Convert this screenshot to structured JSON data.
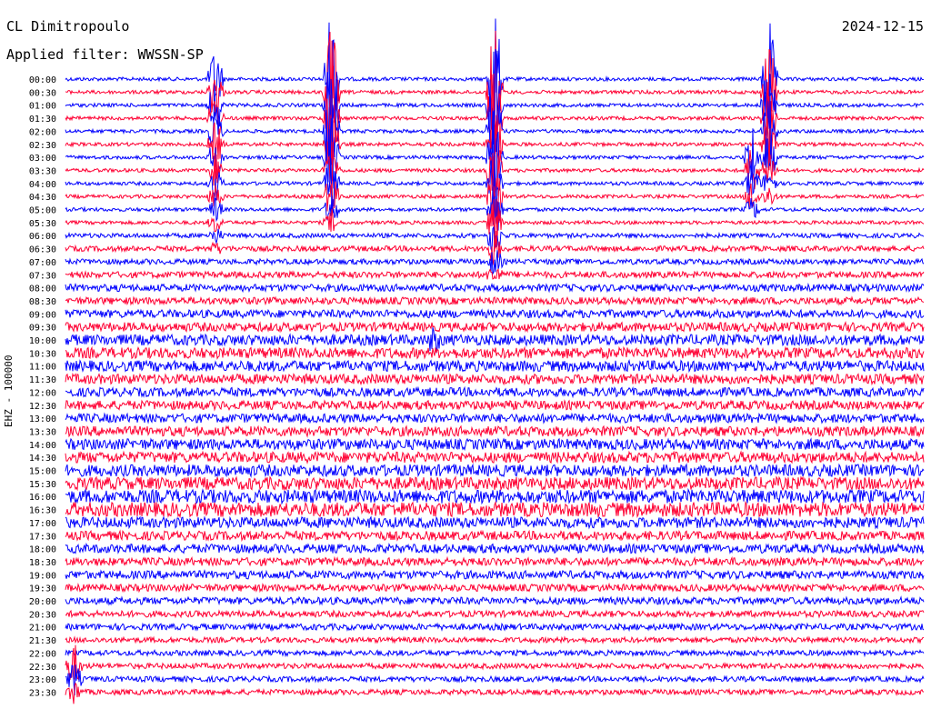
{
  "header": {
    "station": "CL Dimitropoulo",
    "date": "2024-12-15",
    "filter": "Applied filter: WWSSN-SP",
    "channel": "EHZ - 100000"
  },
  "chart_data": {
    "type": "helicorder",
    "title": "CL Dimitropoulo",
    "date": "2024-12-15",
    "filter": "WWSSN-SP",
    "ylabel": "EHZ - 100000",
    "row_minutes": 15,
    "rows": 48,
    "tick_labels": [
      "00:00",
      "00:30",
      "01:00",
      "01:30",
      "02:00",
      "02:30",
      "03:00",
      "03:30",
      "04:00",
      "04:30",
      "05:00",
      "05:30",
      "06:00",
      "06:30",
      "07:00",
      "07:30",
      "08:00",
      "08:30",
      "09:00",
      "09:30",
      "10:00",
      "10:30",
      "11:00",
      "11:30",
      "12:00",
      "12:30",
      "13:00",
      "13:30",
      "14:00",
      "14:30",
      "15:00",
      "15:30",
      "16:00",
      "16:30",
      "17:00",
      "17:30",
      "18:00",
      "18:30",
      "19:00",
      "19:30",
      "20:00",
      "20:30",
      "21:00",
      "21:30",
      "22:00",
      "22:30",
      "23:00",
      "23:30"
    ],
    "trace_colors": [
      "#0000ff",
      "#ff0033"
    ],
    "noise_profile": [
      2,
      2,
      2,
      2,
      2,
      2,
      2,
      2,
      2,
      2,
      2,
      2,
      2.5,
      3,
      3,
      3.5,
      4,
      4,
      4.5,
      5,
      6,
      6,
      6,
      5.5,
      5,
      5,
      5,
      5.5,
      6,
      6,
      6.5,
      7,
      7.5,
      8,
      6,
      5,
      5,
      4.5,
      4.5,
      4,
      4,
      3.5,
      3.5,
      3,
      3,
      3,
      3,
      3
    ],
    "events": [
      {
        "row": 0,
        "x_frac": 0.31,
        "amp": 90,
        "rows_span": 12
      },
      {
        "row": 0,
        "x_frac": 0.5,
        "amp": 90,
        "rows_span": 16
      },
      {
        "row": 0,
        "x_frac": 0.82,
        "amp": 70,
        "rows_span": 10
      },
      {
        "row": 0,
        "x_frac": 0.175,
        "amp": 40,
        "rows_span": 14
      },
      {
        "row": 6,
        "x_frac": 0.8,
        "amp": 40,
        "rows_span": 5
      },
      {
        "row": 20,
        "x_frac": 0.43,
        "amp": 12,
        "rows_span": 1
      },
      {
        "row": 45,
        "x_frac": 0.01,
        "amp": 25,
        "rows_span": 3
      }
    ]
  }
}
